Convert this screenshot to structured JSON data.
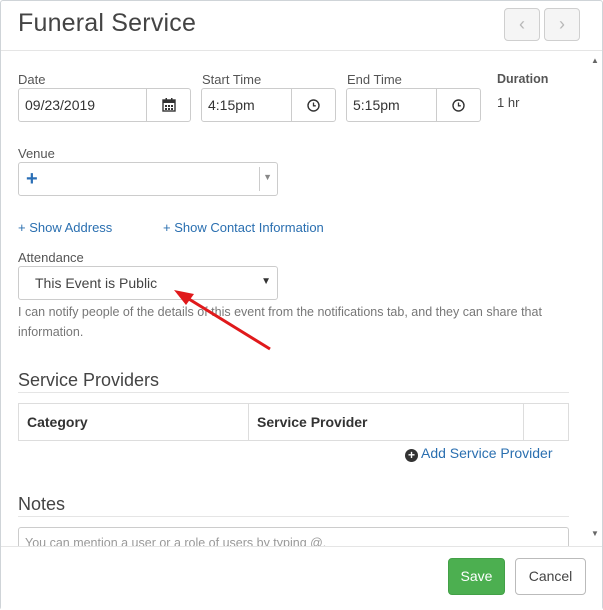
{
  "header": {
    "title": "Funeral Service",
    "prev_icon": "‹",
    "next_icon": "›"
  },
  "form": {
    "date": {
      "label": "Date",
      "value": "09/23/2019",
      "icon": "calendar-icon"
    },
    "start_time": {
      "label": "Start Time",
      "value": "4:15pm",
      "icon": "clock-icon"
    },
    "end_time": {
      "label": "End Time",
      "value": "5:15pm",
      "icon": "clock-icon"
    },
    "duration": {
      "label": "Duration",
      "value": "1 hr"
    },
    "venue": {
      "label": "Venue",
      "value": ""
    },
    "show_address": "+ Show Address",
    "show_contact": "+ Show Contact Information",
    "attendance": {
      "label": "Attendance",
      "selected": "This Event is Public",
      "help": "I can notify people of the details of this event from the notifications tab, and they can share that information."
    }
  },
  "service_providers": {
    "title": "Service Providers",
    "columns": [
      "Category",
      "Service Provider",
      ""
    ],
    "add_label": "Add Service Provider"
  },
  "notes": {
    "title": "Notes",
    "placeholder": "You can mention a user or a role of users by typing @."
  },
  "footer": {
    "save_label": "Save",
    "cancel_label": "Cancel"
  },
  "colors": {
    "link": "#2a6fb0",
    "save": "#4caf50",
    "annotation_arrow": "#e0191b"
  }
}
